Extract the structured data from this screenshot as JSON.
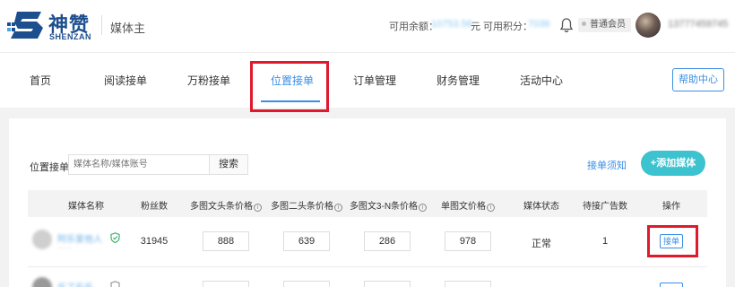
{
  "brand": {
    "name_cn": "神赞",
    "name_en": "SHENZAN",
    "role": "媒体主",
    "accent": "#1d4f8e"
  },
  "header": {
    "balance_label": "可用余额：",
    "balance_value": "10753.56",
    "balance_unit": "元",
    "points_label": "可用积分：",
    "points_value": "7036",
    "member_badge": "普通会员",
    "username": "13777459745"
  },
  "nav": {
    "items": [
      {
        "label": "首页"
      },
      {
        "label": "阅读接单"
      },
      {
        "label": "万粉接单"
      },
      {
        "label": "位置接单",
        "active": true
      },
      {
        "label": "订单管理"
      },
      {
        "label": "财务管理"
      },
      {
        "label": "活动中心"
      }
    ],
    "help_label": "帮助中心"
  },
  "search": {
    "label": "位置接单",
    "placeholder": "媒体名称/媒体账号",
    "button": "搜索",
    "notice_link": "接单须知",
    "add_button": "+添加媒体"
  },
  "table": {
    "columns": [
      "媒体名称",
      "粉丝数",
      "多图文头条价格",
      "多图二头条价格",
      "多图文3-N条价格",
      "单图文价格",
      "媒体状态",
      "待接广告数",
      "操作"
    ],
    "rows": [
      {
        "name": "阿乐爱他人",
        "sub": "……",
        "fans": "31945",
        "p1": "888",
        "p2": "639",
        "p3": "286",
        "p4": "978",
        "status": "正常",
        "pending": "1",
        "action": "接单"
      },
      {
        "name": "乐了乐乐",
        "sub": "",
        "fans": "",
        "p1": "",
        "p2": "",
        "p3": "",
        "p4": "",
        "status": "",
        "pending": "",
        "action": ""
      }
    ]
  },
  "colors": {
    "primary": "#3a8ee6",
    "teal": "#3dc2cf",
    "highlight": "#e0192c"
  }
}
